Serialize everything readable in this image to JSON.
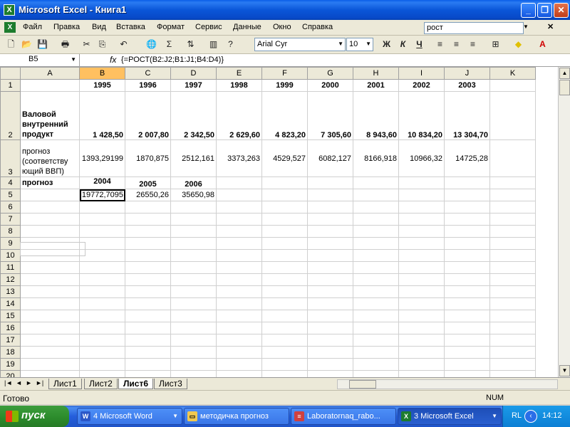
{
  "window": {
    "title": "Microsoft Excel - Книга1",
    "min": "_",
    "max": "❐",
    "close": "✕"
  },
  "menu": {
    "items": [
      "Файл",
      "Правка",
      "Вид",
      "Вставка",
      "Формат",
      "Сервис",
      "Данные",
      "Окно",
      "Справка"
    ],
    "help_query": "рост"
  },
  "toolbar": {
    "font": "Arial Cyr",
    "size": "10",
    "bold": "Ж",
    "italic": "К",
    "underline": "Ч"
  },
  "formula_bar": {
    "name_box": "B5",
    "fx": "fx",
    "formula": "{=РОСТ(B2:J2;B1:J1;B4:D4)}"
  },
  "columns": [
    "A",
    "B",
    "C",
    "D",
    "E",
    "F",
    "G",
    "H",
    "I",
    "J",
    "K"
  ],
  "rows": [
    "1",
    "2",
    "3",
    "4",
    "5",
    "6",
    "7",
    "8",
    "9",
    "10",
    "11",
    "12",
    "13",
    "14",
    "15",
    "16",
    "17",
    "18",
    "19",
    "20"
  ],
  "cells": {
    "B1": "1995",
    "C1": "1996",
    "D1": "1997",
    "E1": "1998",
    "F1": "1999",
    "G1": "2000",
    "H1": "2001",
    "I1": "2002",
    "J1": "2003",
    "A2": "Валовой внутренний продукт",
    "B2": "1 428,50",
    "C2": "2 007,80",
    "D2": "2 342,50",
    "E2": "2 629,60",
    "F2": "4 823,20",
    "G2": "7 305,60",
    "H2": "8 943,60",
    "I2": "10 834,20",
    "J2": "13 304,70",
    "A3": "прогноз (соответству ющий ВВП)",
    "B3": "1393,29199",
    "C3": "1870,875",
    "D3": "2512,161",
    "E3": "3373,263",
    "F3": "4529,527",
    "G3": "6082,127",
    "H3": "8166,918",
    "I3": "10966,32",
    "J3": "14725,28",
    "A4": "прогноз",
    "B4": "2004",
    "C4": "2005",
    "D4": "2006",
    "B5": "19772,7095",
    "C5": "26550,26",
    "D5": "35650,98"
  },
  "sheets": {
    "nav": [
      "|◄",
      "◄",
      "►",
      "►|"
    ],
    "tabs": [
      "Лист1",
      "Лист2",
      "Лист6",
      "Лист3"
    ],
    "active": "Лист6"
  },
  "status": {
    "text": "Готово",
    "num": "NUM"
  },
  "taskbar": {
    "start": "пуск",
    "tasks": [
      "4 Microsoft Word",
      "методичка прогноз",
      "Laboratornaq_rabo...",
      "3 Microsoft Excel"
    ],
    "lang": "RL",
    "clock": "14:12"
  }
}
